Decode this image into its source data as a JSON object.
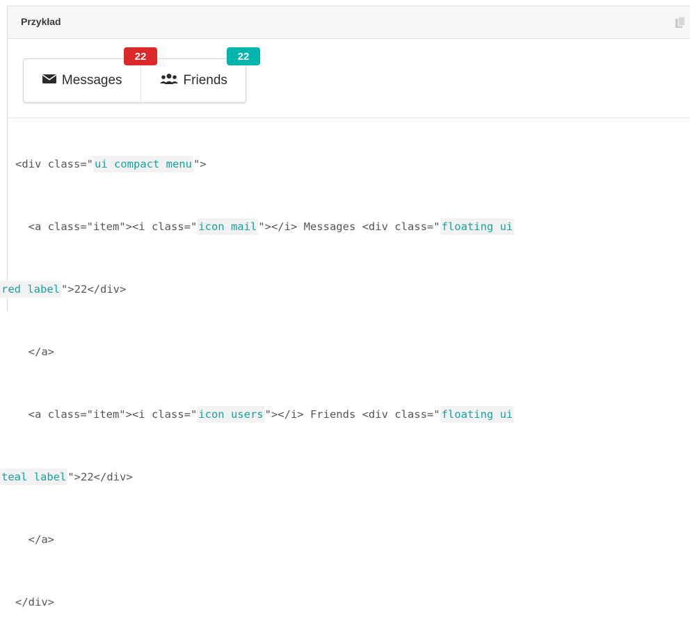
{
  "header": {
    "title": "Przykład",
    "copy_icon": "copy-icon"
  },
  "menu": {
    "items": [
      {
        "label": "Messages",
        "icon": "mail-icon",
        "badge": "22",
        "badge_color": "#db2828"
      },
      {
        "label": "Friends",
        "icon": "users-icon",
        "badge": "22",
        "badge_color": "#00b5ad"
      }
    ]
  },
  "code": {
    "l1": {
      "a": "<div class=\"",
      "v": "ui compact menu",
      "b": "\">"
    },
    "l2": {
      "a": "  <a class=\"item\"><i class=\"",
      "v1": "icon mail",
      "b": "\"></i> Messages <div class=\"",
      "v2": "floating ui"
    },
    "l3": {
      "v": "red label",
      "b": "\">22</div>"
    },
    "l4": "  </a>",
    "l5": {
      "a": "  <a class=\"item\"><i class=\"",
      "v1": "icon users",
      "b": "\"></i> Friends <div class=\"",
      "v2": "floating ui"
    },
    "l6": {
      "v": "teal label",
      "b": "\">22</div>"
    },
    "l7": "  </a>",
    "l8": "</div>"
  }
}
